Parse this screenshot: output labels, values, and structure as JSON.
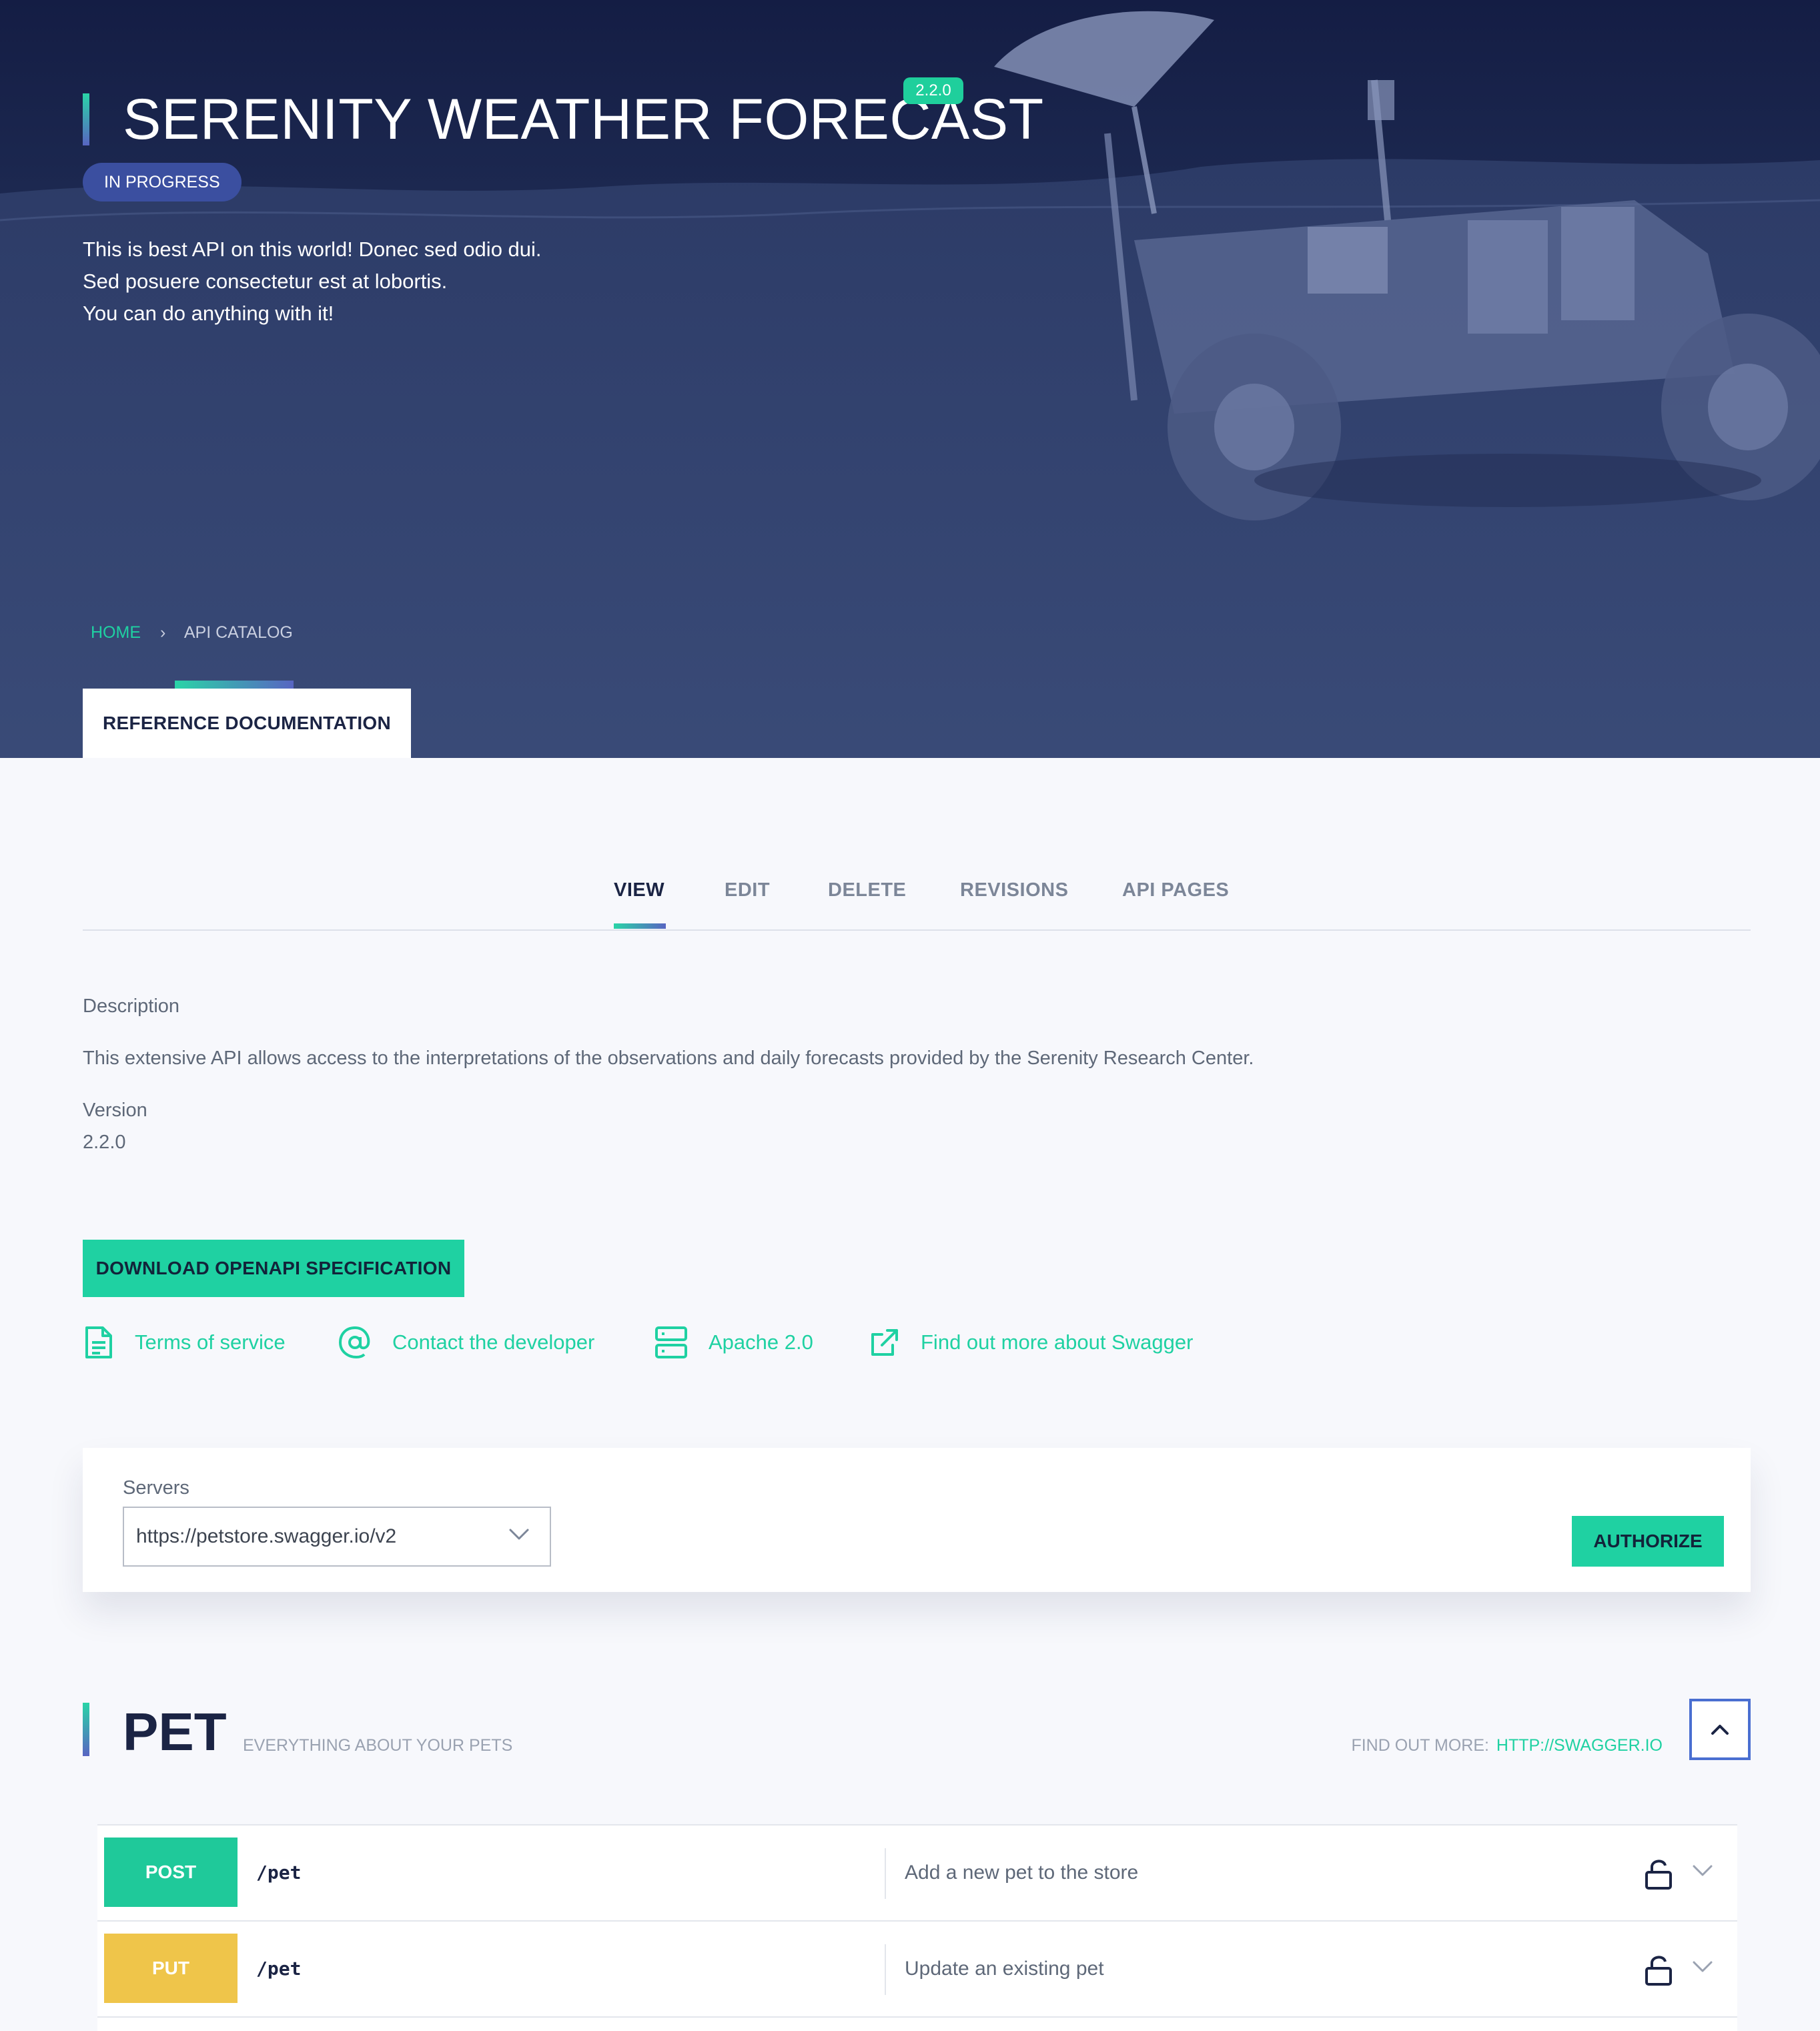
{
  "hero": {
    "title": "SERENITY WEATHER FORECAST",
    "version_badge": "2.2.0",
    "status": "IN PROGRESS",
    "description_lines": [
      "This is best API on this world! Donec sed odio dui.",
      "Sed posuere consectetur est at lobortis.",
      "You can do anything with it!"
    ],
    "breadcrumb": {
      "home": "HOME",
      "separator": "›",
      "current": "API CATALOG"
    },
    "ref_tab": "REFERENCE DOCUMENTATION"
  },
  "tabs": [
    {
      "label": "VIEW",
      "active": true
    },
    {
      "label": "EDIT",
      "active": false
    },
    {
      "label": "DELETE",
      "active": false
    },
    {
      "label": "REVISIONS",
      "active": false
    },
    {
      "label": "API PAGES",
      "active": false
    }
  ],
  "info": {
    "description_label": "Description",
    "description_text": "This extensive API allows access to the interpretations of the observations and daily forecasts provided by the Serenity Research Center.",
    "version_label": "Version",
    "version_value": "2.2.0"
  },
  "download_button": "DOWNLOAD OPENAPI SPECIFICATION",
  "links": [
    {
      "icon": "document-icon",
      "label": "Terms of service"
    },
    {
      "icon": "at-sign-icon",
      "label": "Contact the developer"
    },
    {
      "icon": "server-icon",
      "label": "Apache 2.0"
    },
    {
      "icon": "external-link-icon",
      "label": "Find out more about Swagger"
    }
  ],
  "servers": {
    "label": "Servers",
    "selected": "https://petstore.swagger.io/v2",
    "authorize_label": "AUTHORIZE"
  },
  "section": {
    "title": "PET",
    "subtitle": "EVERYTHING ABOUT YOUR PETS",
    "find_more_label": "FIND OUT MORE:",
    "find_more_link": "HTTP://SWAGGER.IO"
  },
  "operations": [
    {
      "method": "POST",
      "path": "/pet",
      "summary": "Add a new pet to the store",
      "color": "#1fc99a"
    },
    {
      "method": "PUT",
      "path": "/pet",
      "summary": "Update an existing pet",
      "color": "#efc54a"
    }
  ],
  "colors": {
    "accent": "#1fd1a2",
    "hero_bg": "#1c2850",
    "status_badge": "#3b4fa0"
  }
}
